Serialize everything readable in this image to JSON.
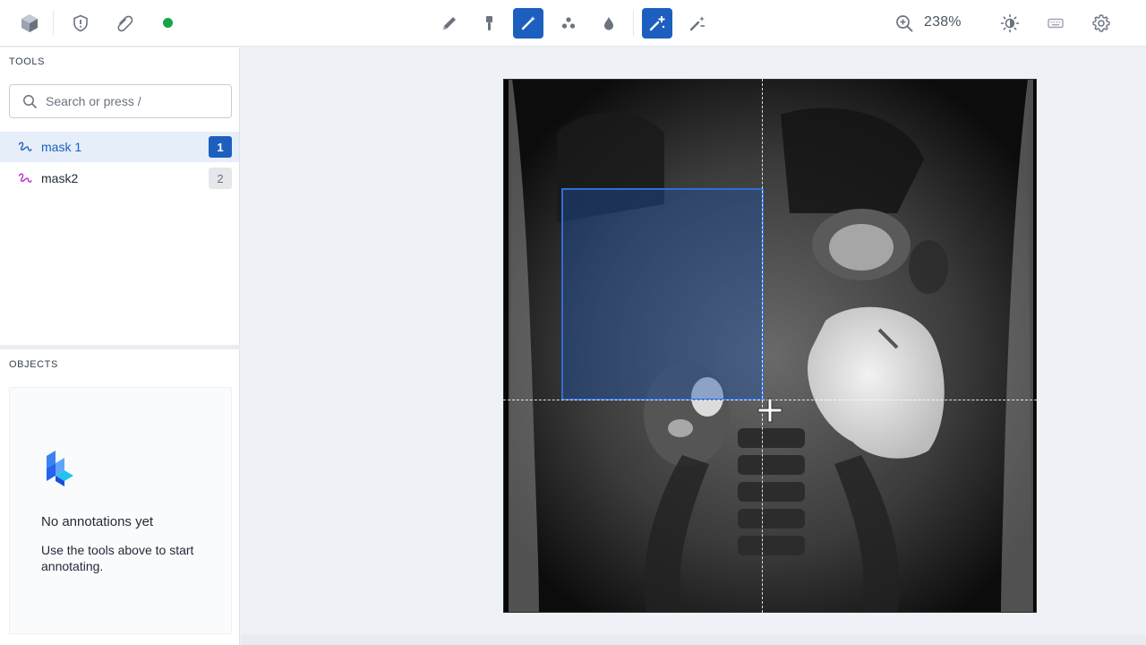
{
  "toolbar": {
    "zoom": "238%",
    "status_color": "#16a34a",
    "accent_color": "#1d5fbf",
    "left_tools": [
      "logo-cube-icon",
      "shield-alert-icon",
      "paperclip-icon",
      "status-dot"
    ],
    "center_tools": [
      "pencil-icon",
      "brush-icon",
      "magic-wand-icon",
      "nodes-icon",
      "drop-icon"
    ],
    "mode_tools": [
      "magic-wand-plus-icon",
      "magic-wand-eraser-icon"
    ],
    "right_tools": [
      "zoom-in-icon",
      "brightness-icon",
      "keyboard-icon",
      "gear-icon"
    ]
  },
  "tools_panel": {
    "title": "TOOLS",
    "search_placeholder": "Search or press /",
    "items": [
      {
        "label": "mask 1",
        "shortcut": "1",
        "selected": true,
        "icon_color": "#1d5fbf"
      },
      {
        "label": "mask2",
        "shortcut": "2",
        "selected": false,
        "icon_color": "#c026d3"
      }
    ]
  },
  "objects_panel": {
    "title": "OBJECTS",
    "empty_title": "No annotations yet",
    "empty_description": "Use the tools above to start annotating."
  }
}
